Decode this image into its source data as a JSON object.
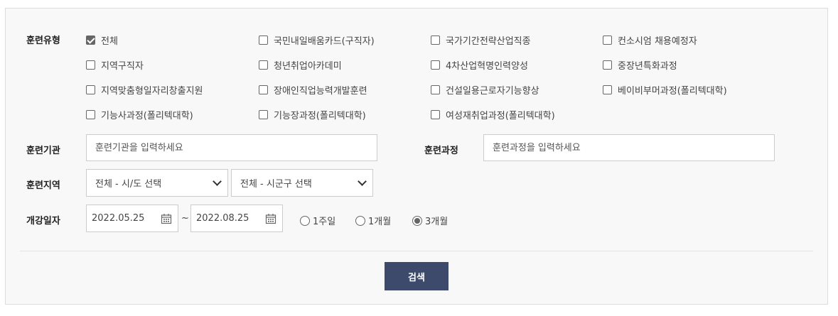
{
  "labels": {
    "training_type": "훈련유형",
    "institution": "훈련기관",
    "course": "훈련과정",
    "region": "훈련지역",
    "start_date": "개강일자"
  },
  "checkboxes": [
    {
      "label": "전체",
      "checked": true
    },
    {
      "label": "국민내일배움카드(구직자)",
      "checked": false
    },
    {
      "label": "국가기간전략산업직종",
      "checked": false
    },
    {
      "label": "컨소시엄 채용예정자",
      "checked": false
    },
    {
      "label": "지역구직자",
      "checked": false
    },
    {
      "label": "청년취업아카데미",
      "checked": false
    },
    {
      "label": "4차산업혁명인력양성",
      "checked": false
    },
    {
      "label": "중장년특화과정",
      "checked": false
    },
    {
      "label": "지역맞춤형일자리창출지원",
      "checked": false
    },
    {
      "label": "장애인직업능력개발훈련",
      "checked": false
    },
    {
      "label": "건설일용근로자기능향상",
      "checked": false
    },
    {
      "label": "베이비부머과정(폴리텍대학)",
      "checked": false
    },
    {
      "label": "기능사과정(폴리텍대학)",
      "checked": false
    },
    {
      "label": "기능장과정(폴리텍대학)",
      "checked": false
    },
    {
      "label": "여성재취업과정(폴리텍대학)",
      "checked": false
    }
  ],
  "inputs": {
    "institution_placeholder": "훈련기관을 입력하세요",
    "course_placeholder": "훈련과정을 입력하세요"
  },
  "selects": {
    "province": "전체 - 시/도 선택",
    "district": "전체 - 시군구 선택"
  },
  "dates": {
    "from": "2022.05.25",
    "separator": "~",
    "to": "2022.08.25"
  },
  "periods": [
    {
      "label": "1주일",
      "selected": false
    },
    {
      "label": "1개월",
      "selected": false
    },
    {
      "label": "3개월",
      "selected": true
    }
  ],
  "search_button": "검색",
  "colors": {
    "button_bg": "#3d4a6b",
    "panel_bg": "#f8f8f8"
  }
}
